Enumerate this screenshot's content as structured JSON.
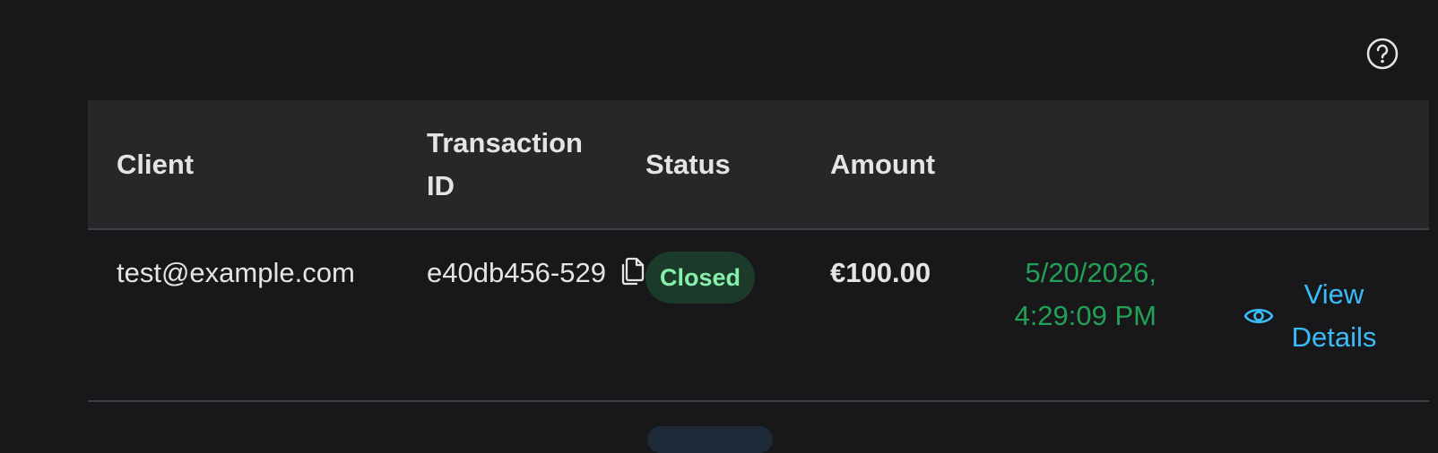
{
  "help": {
    "icon": "question-circle-icon"
  },
  "table": {
    "headers": {
      "client": "Client",
      "transaction_id": "Transaction ID",
      "status": "Status",
      "amount": "Amount",
      "date": "",
      "actions": ""
    },
    "rows": [
      {
        "client": "test@example.com",
        "transaction_id": "e40db456-529",
        "status": "Closed",
        "amount": "€100.00",
        "date": "5/20/2026, 4:29:09 PM",
        "action_label": "View Details"
      }
    ]
  },
  "colors": {
    "background": "#18181b",
    "header_bg": "#27272a",
    "status_closed_bg": "#1c3a2a",
    "status_closed_text": "#86efac",
    "date_text": "#22a055",
    "link": "#38bdf8"
  }
}
